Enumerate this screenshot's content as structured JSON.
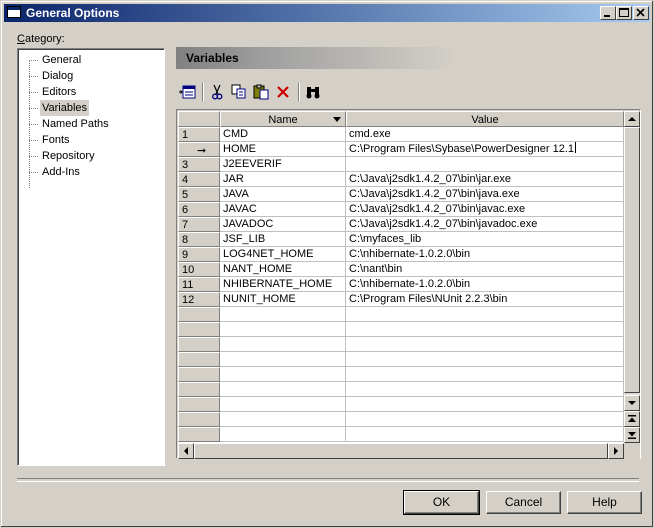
{
  "window": {
    "title": "General Options"
  },
  "category": {
    "label_accel": "C",
    "label_rest": "ategory:",
    "items": [
      {
        "label": "General"
      },
      {
        "label": "Dialog"
      },
      {
        "label": "Editors"
      },
      {
        "label": "Variables",
        "selected": true
      },
      {
        "label": "Named Paths"
      },
      {
        "label": "Fonts"
      },
      {
        "label": "Repository"
      },
      {
        "label": "Add-Ins"
      }
    ]
  },
  "panel": {
    "title": "Variables"
  },
  "toolbar": {
    "icons": [
      "properties-icon",
      "cut-icon",
      "copy-icon",
      "paste-icon",
      "delete-icon",
      "find-icon"
    ]
  },
  "grid": {
    "columns": {
      "name": "Name",
      "value": "Value"
    },
    "rows": [
      {
        "num": "1",
        "name": "CMD",
        "value": "cmd.exe"
      },
      {
        "num": "",
        "current": true,
        "name": "HOME",
        "value": "C:\\Program Files\\Sybase\\PowerDesigner 12.1"
      },
      {
        "num": "3",
        "name": "J2EEVERIF",
        "value": ""
      },
      {
        "num": "4",
        "name": "JAR",
        "value": "C:\\Java\\j2sdk1.4.2_07\\bin\\jar.exe"
      },
      {
        "num": "5",
        "name": "JAVA",
        "value": "C:\\Java\\j2sdk1.4.2_07\\bin\\java.exe"
      },
      {
        "num": "6",
        "name": "JAVAC",
        "value": "C:\\Java\\j2sdk1.4.2_07\\bin\\javac.exe"
      },
      {
        "num": "7",
        "name": "JAVADOC",
        "value": "C:\\Java\\j2sdk1.4.2_07\\bin\\javadoc.exe"
      },
      {
        "num": "8",
        "name": "JSF_LIB",
        "value": "C:\\myfaces_lib"
      },
      {
        "num": "9",
        "name": "LOG4NET_HOME",
        "value": "C:\\nhibernate-1.0.2.0\\bin"
      },
      {
        "num": "10",
        "name": "NANT_HOME",
        "value": "C:\\nant\\bin"
      },
      {
        "num": "11",
        "name": "NHIBERNATE_HOME",
        "value": "C:\\nhibernate-1.0.2.0\\bin"
      },
      {
        "num": "12",
        "name": "NUNIT_HOME",
        "value": "C:\\Program Files\\NUnit 2.2.3\\bin"
      },
      {
        "num": "",
        "name": "",
        "value": ""
      },
      {
        "num": "",
        "name": "",
        "value": ""
      },
      {
        "num": "",
        "name": "",
        "value": ""
      },
      {
        "num": "",
        "name": "",
        "value": ""
      },
      {
        "num": "",
        "name": "",
        "value": ""
      },
      {
        "num": "",
        "name": "",
        "value": ""
      },
      {
        "num": "",
        "name": "",
        "value": ""
      },
      {
        "num": "",
        "name": "",
        "value": ""
      },
      {
        "num": "",
        "name": "",
        "value": ""
      }
    ]
  },
  "buttons": {
    "ok": "OK",
    "cancel": "Cancel",
    "help": "Help"
  }
}
